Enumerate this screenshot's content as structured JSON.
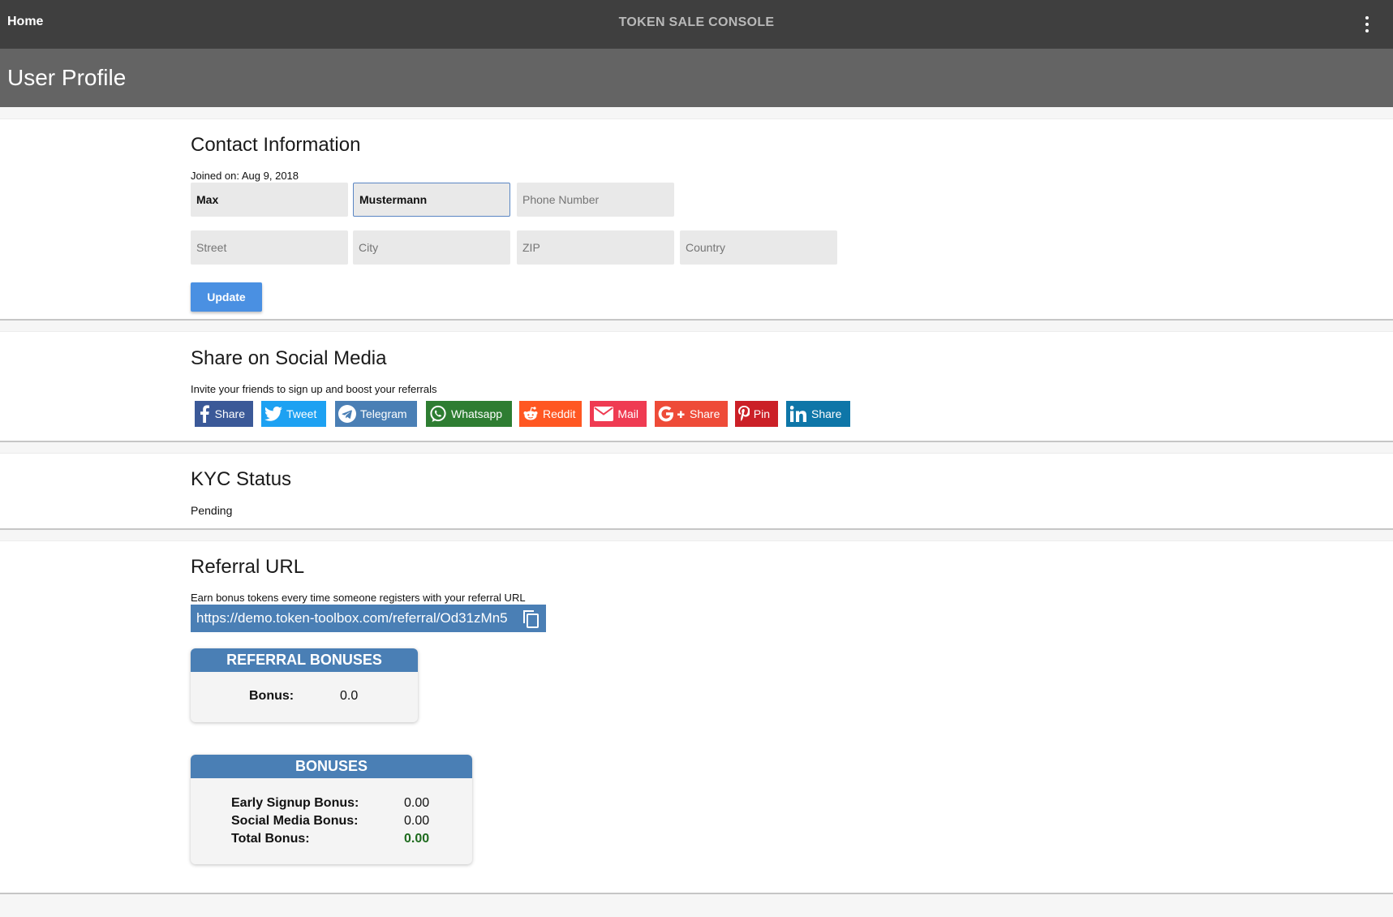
{
  "topbar": {
    "home": "Home",
    "title": "TOKEN SALE CONSOLE"
  },
  "header": {
    "title": "User Profile"
  },
  "contact": {
    "title": "Contact Information",
    "joined": "Joined on: Aug 9, 2018",
    "first_name": "Max",
    "last_name": "Mustermann",
    "phone_placeholder": "Phone Number",
    "street_placeholder": "Street",
    "city_placeholder": "City",
    "zip_placeholder": "ZIP",
    "country_placeholder": "Country",
    "update_label": "Update"
  },
  "social": {
    "title": "Share on Social Media",
    "subtitle": "Invite your friends to sign up and boost your referrals",
    "buttons": [
      {
        "label": "Share",
        "icon": "facebook-icon",
        "color": "#3b5998"
      },
      {
        "label": "Tweet",
        "icon": "twitter-icon",
        "color": "#1da1f2"
      },
      {
        "label": "Telegram",
        "icon": "telegram-icon",
        "color": "#4a7fb5"
      },
      {
        "label": "Whatsapp",
        "icon": "whatsapp-icon",
        "color": "#2e7d32"
      },
      {
        "label": "Reddit",
        "icon": "reddit-icon",
        "color": "#ff5722"
      },
      {
        "label": "Mail",
        "icon": "mail-icon",
        "color": "#ef3b52"
      },
      {
        "label": "Share",
        "icon": "google-plus-icon",
        "color": "#ee4b38"
      },
      {
        "label": "Pin",
        "icon": "pinterest-icon",
        "color": "#cb2027"
      },
      {
        "label": "Share",
        "icon": "linkedin-icon",
        "color": "#0e76a8"
      }
    ]
  },
  "kyc": {
    "title": "KYC Status",
    "status": "Pending"
  },
  "referral": {
    "title": "Referral URL",
    "subtitle": "Earn bonus tokens every time someone registers with your referral URL",
    "url": "https://demo.token-toolbox.com/referral/Od31zMn5",
    "bonuses_title": "REFERRAL BONUSES",
    "bonus_label": "Bonus:",
    "bonus_value": "0.0"
  },
  "bonuses": {
    "title": "BONUSES",
    "early_label": "Early Signup Bonus:",
    "early_value": "0.00",
    "social_label": "Social Media Bonus:",
    "social_value": "0.00",
    "total_label": "Total Bonus:",
    "total_value": "0.00"
  }
}
